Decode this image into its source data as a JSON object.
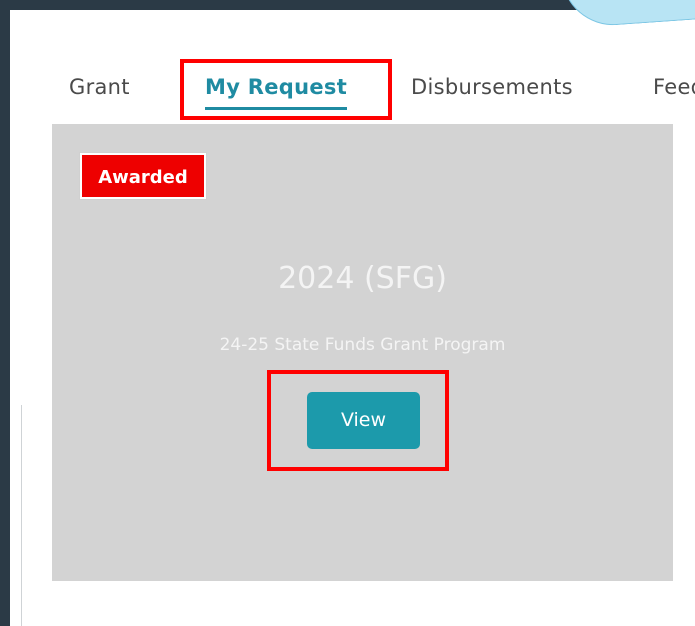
{
  "tabs": [
    {
      "label": "Grant"
    },
    {
      "label": "My Request"
    },
    {
      "label": "Disbursements"
    },
    {
      "label": "Feedback"
    }
  ],
  "card": {
    "badge": "Awarded",
    "title": "2024 (SFG)",
    "subtitle": "24-25 State Funds Grant Program",
    "view_label": "View"
  },
  "colors": {
    "accent": "#1f8ba2",
    "badge_bg": "#ee0000",
    "card_bg": "#d3d3d3",
    "highlight": "#ff0000",
    "button_bg": "#1c9aab"
  }
}
